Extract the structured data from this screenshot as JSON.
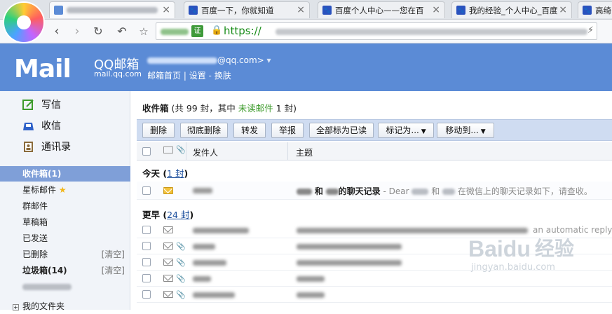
{
  "browser": {
    "tabs": [
      {
        "label": "",
        "blurred": true
      },
      {
        "label": "百度一下，你就知道"
      },
      {
        "label": "百度个人中心——您在百"
      },
      {
        "label": "我的经验_个人中心_百度"
      },
      {
        "label": "高绮"
      }
    ],
    "url_badge": "证",
    "url": "https://"
  },
  "header": {
    "logo": "Mail",
    "brand": "QQ邮箱",
    "domain": "mail.qq.com",
    "account_suffix": "@qq.com>",
    "links": [
      "邮箱首页",
      "设置",
      "换肤"
    ]
  },
  "sidebar": {
    "actions": [
      {
        "label": "写信",
        "icon": "compose-icon"
      },
      {
        "label": "收信",
        "icon": "inbox-icon"
      },
      {
        "label": "通讯录",
        "icon": "contacts-icon"
      }
    ],
    "folders": [
      {
        "label": "收件箱(1)",
        "selected": true
      },
      {
        "label": "星标邮件"
      },
      {
        "label": "群邮件"
      },
      {
        "label": "草稿箱"
      },
      {
        "label": "已发送"
      },
      {
        "label": "已删除",
        "clear": "[清空]"
      },
      {
        "label": "垃圾箱(14)",
        "clear": "[清空]"
      },
      {
        "label": "我的文件夹"
      }
    ]
  },
  "mailbox": {
    "title": "收件箱",
    "count_text": "(共 99 封，其中",
    "unread_link": "未读邮件",
    "unread_count_text": "1 封)",
    "toolbar": [
      "删除",
      "彻底删除",
      "转发",
      "举报",
      "全部标为已读",
      "标记为...",
      "移动到..."
    ],
    "columns": {
      "sender": "发件人",
      "subject": "主题"
    },
    "groups": [
      {
        "label": "今天",
        "count": "1 封"
      },
      {
        "label": "更早",
        "count": "24 封"
      }
    ],
    "today_email": {
      "subject_part1": "和",
      "subject_part2": "的聊天记录",
      "preview_prefix": "- Dear",
      "preview_mid": "和",
      "preview_suffix": "在微信上的聊天记录如下，请查收。"
    },
    "earlier_first_preview": "an automatic reply,"
  },
  "watermark": {
    "brand": "Baidu",
    "cn": "经验",
    "url": "jingyan.baidu.com"
  },
  "colors": {
    "header_blue": "#5b8bd6",
    "selected_folder": "#7f9fd8",
    "toolbar_bg": "#cfdcf1",
    "unread_green": "#3d9b2b"
  }
}
